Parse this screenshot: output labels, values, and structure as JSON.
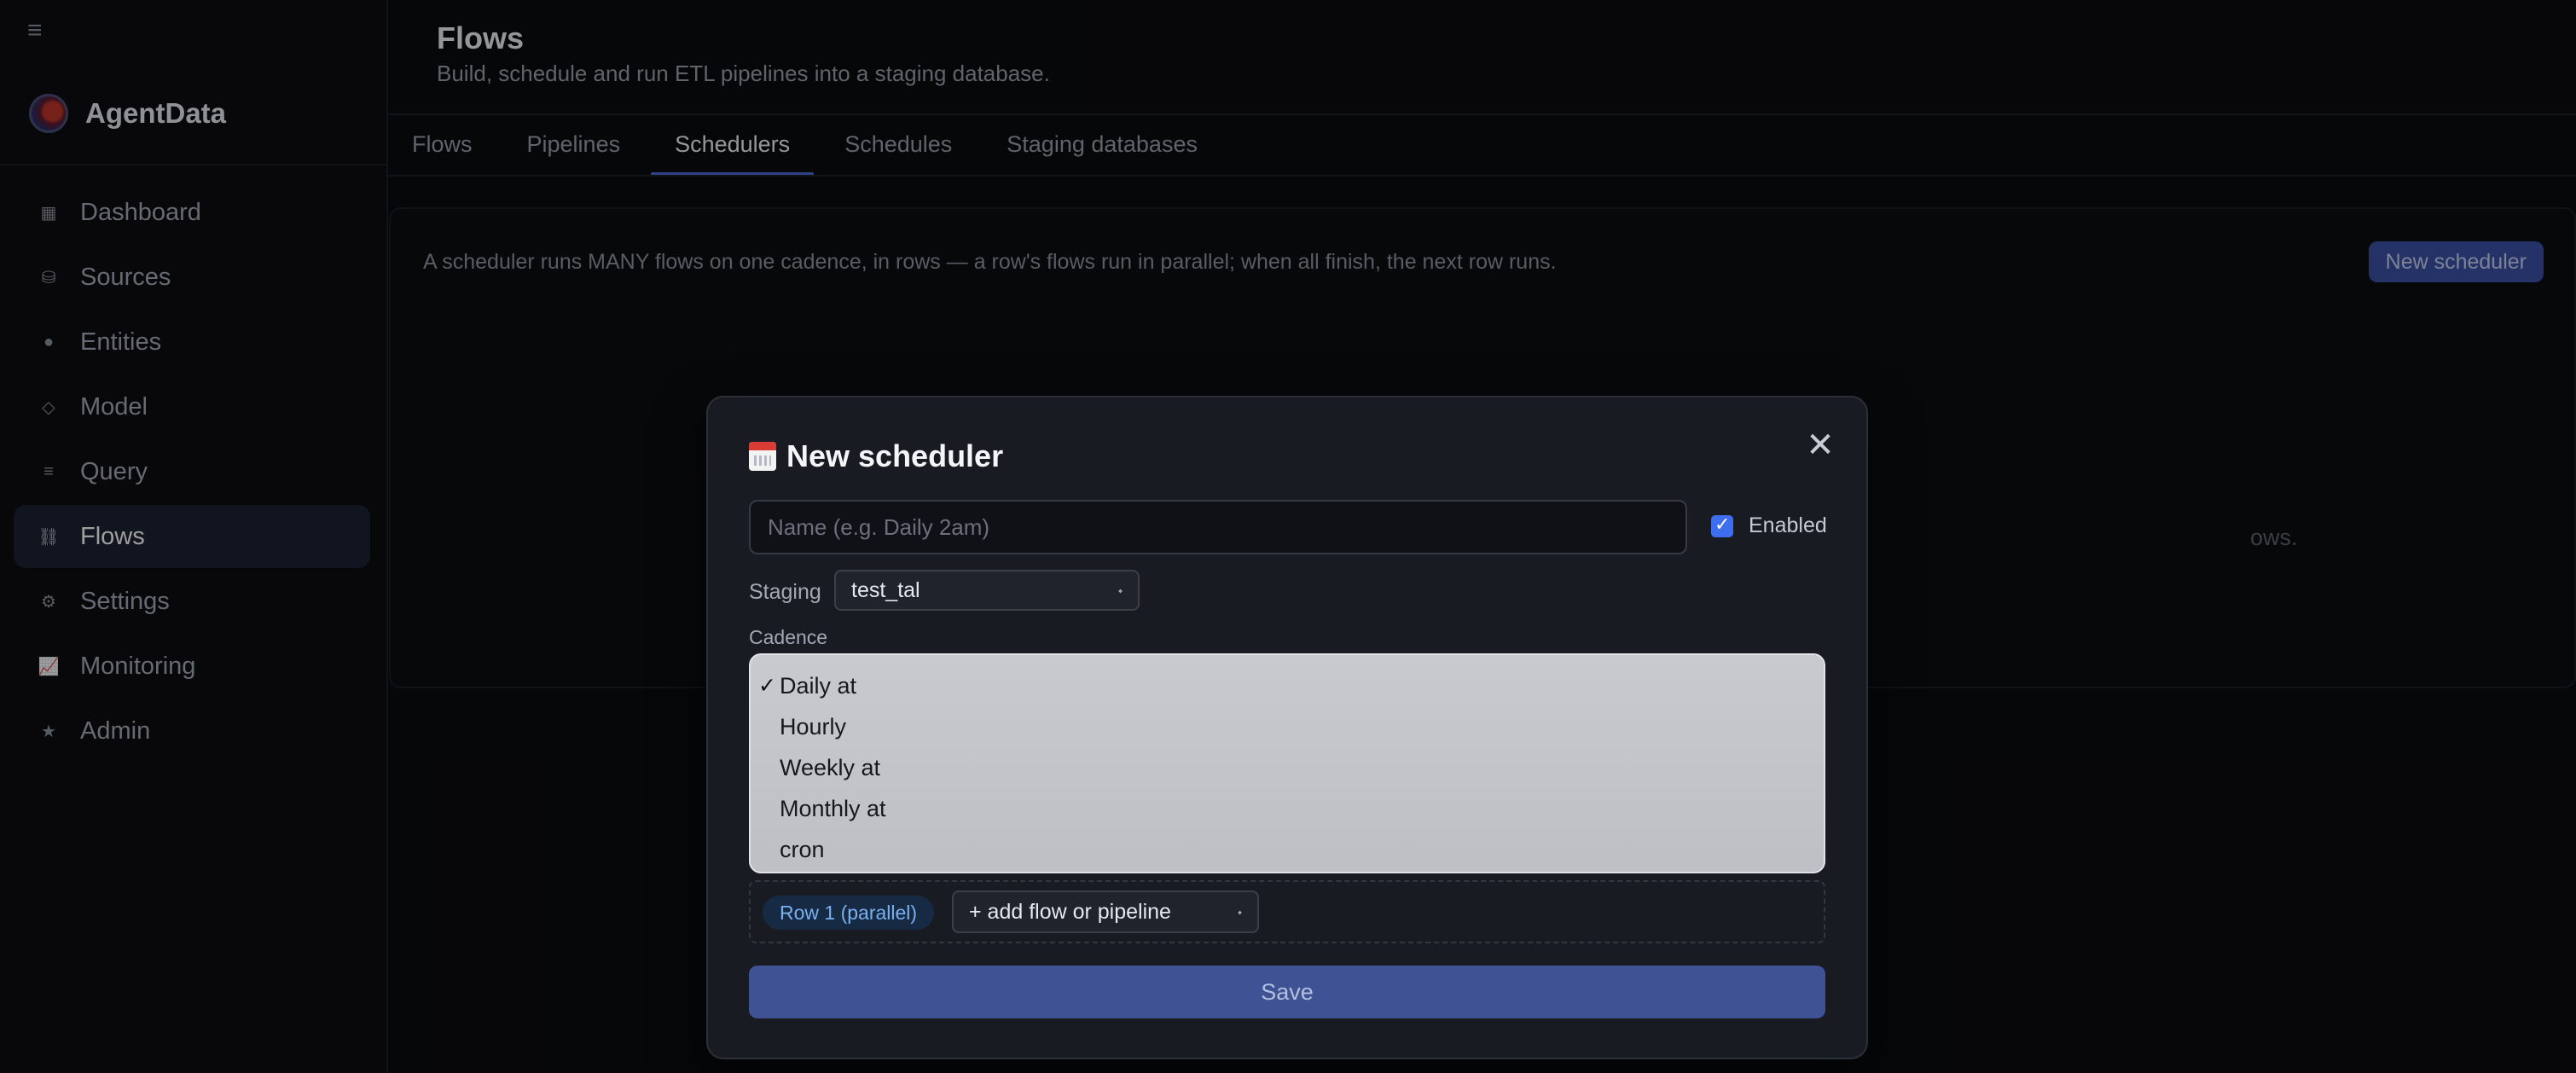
{
  "sidebar": {
    "brand": "AgentData",
    "items": [
      {
        "label": "Dashboard",
        "icon": "▦"
      },
      {
        "label": "Sources",
        "icon": "⛁"
      },
      {
        "label": "Entities",
        "icon": "●"
      },
      {
        "label": "Model",
        "icon": "◇"
      },
      {
        "label": "Query",
        "icon": "≡"
      },
      {
        "label": "Flows",
        "icon": "⛓"
      },
      {
        "label": "Settings",
        "icon": "⚙"
      },
      {
        "label": "Monitoring",
        "icon": "📈"
      },
      {
        "label": "Admin",
        "icon": "★"
      }
    ],
    "active": "Flows"
  },
  "header": {
    "title": "Flows",
    "subtitle": "Build, schedule and run ETL pipelines into a staging database."
  },
  "tabs": [
    "Flows",
    "Pipelines",
    "Schedulers",
    "Schedules",
    "Staging databases"
  ],
  "active_tab": "Schedulers",
  "panel": {
    "description": "A scheduler runs MANY flows on one cadence, in rows — a row's flows run in parallel; when all finish, the next row runs.",
    "new_button": "New scheduler",
    "empty_fragment": "ows."
  },
  "modal": {
    "title": "New scheduler",
    "close": "✕",
    "name_placeholder": "Name (e.g. Daily 2am)",
    "enabled_label": "Enabled",
    "enabled": true,
    "staging_label": "Staging",
    "staging_value": "test_tal",
    "cadence_label": "Cadence",
    "cadence_options": [
      "Daily at",
      "Hourly",
      "Weekly at",
      "Monthly at",
      "cron"
    ],
    "cadence_selected": "Daily at",
    "row_badge": "Row 1 (parallel)",
    "add_placeholder": "+ add flow or pipeline",
    "save": "Save"
  }
}
